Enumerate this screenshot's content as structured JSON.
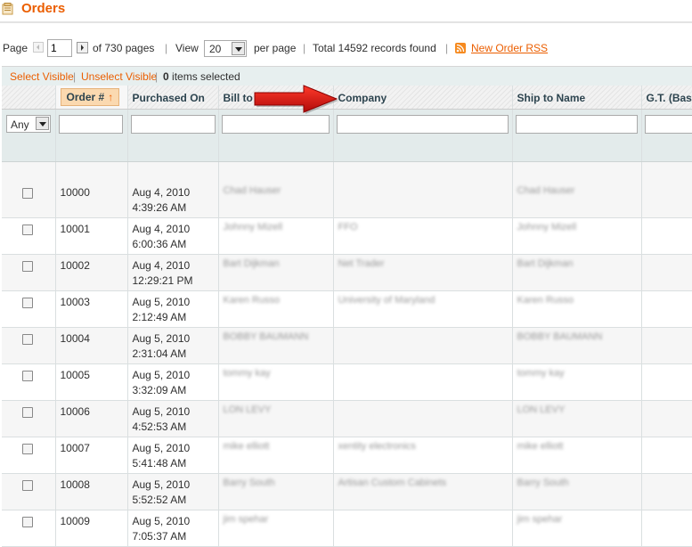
{
  "page": {
    "title": "Orders",
    "accent_color": "#eb5e00"
  },
  "pager": {
    "page_label": "Page",
    "current_page": "1",
    "of_pages": "of 730 pages",
    "view_label": "View",
    "per_page": "20",
    "per_page_label": "per page",
    "total_label": "Total 14592 records found",
    "rss_label": "New Order RSS",
    "separator": "|"
  },
  "massaction": {
    "select_visible": "Select Visible",
    "unselect_visible": "Unselect Visible",
    "selected_count": "0",
    "selected_suffix": " items selected",
    "separator": "|"
  },
  "grid": {
    "columns": [
      "Order #",
      "Purchased On",
      "Bill to",
      "Company",
      "Ship to Name",
      "G.T. (Base"
    ],
    "sort_indicator": "↑",
    "filter_any": "Any",
    "rows": [
      {
        "order": "10000",
        "date": "Aug 4, 2010",
        "time": "4:39:26 AM",
        "bill_to": "Chad Hauser",
        "company": "",
        "ship_to": "Chad Hauser"
      },
      {
        "order": "10001",
        "date": "Aug 4, 2010",
        "time": "6:00:36 AM",
        "bill_to": "Johnny Mizell",
        "company": "FFO",
        "ship_to": "Johnny Mizell"
      },
      {
        "order": "10002",
        "date": "Aug 4, 2010",
        "time": "12:29:21 PM",
        "bill_to": "Bart Dijkman",
        "company": "Net Trader",
        "ship_to": "Bart Dijkman"
      },
      {
        "order": "10003",
        "date": "Aug 5, 2010",
        "time": "2:12:49 AM",
        "bill_to": "Karen Russo",
        "company": "University of Maryland",
        "ship_to": "Karen Russo"
      },
      {
        "order": "10004",
        "date": "Aug 5, 2010",
        "time": "2:31:04 AM",
        "bill_to": "BOBBY BAUMANN",
        "company": "",
        "ship_to": "BOBBY BAUMANN"
      },
      {
        "order": "10005",
        "date": "Aug 5, 2010",
        "time": "3:32:09 AM",
        "bill_to": "tommy kay",
        "company": "",
        "ship_to": "tommy kay"
      },
      {
        "order": "10006",
        "date": "Aug 5, 2010",
        "time": "4:52:53 AM",
        "bill_to": "LON LEVY",
        "company": "",
        "ship_to": "LON LEVY"
      },
      {
        "order": "10007",
        "date": "Aug 5, 2010",
        "time": "5:41:48 AM",
        "bill_to": "mike elliott",
        "company": "xentity electronics",
        "ship_to": "mike elliott"
      },
      {
        "order": "10008",
        "date": "Aug 5, 2010",
        "time": "5:52:52 AM",
        "bill_to": "Barry South",
        "company": "Artisan Custom Cabinets",
        "ship_to": "Barry South"
      },
      {
        "order": "10009",
        "date": "Aug 5, 2010",
        "time": "7:05:37 AM",
        "bill_to": "jim spehar",
        "company": "",
        "ship_to": "jim spehar"
      }
    ]
  }
}
